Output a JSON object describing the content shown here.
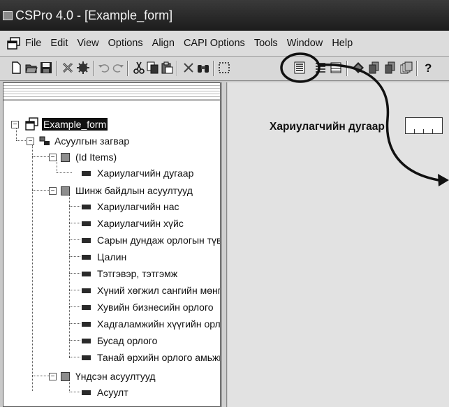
{
  "window": {
    "title": "CSPro 4.0 - [Example_form]"
  },
  "menu": {
    "items": [
      "File",
      "Edit",
      "View",
      "Options",
      "Align",
      "CAPI Options",
      "Tools",
      "Window",
      "Help"
    ]
  },
  "toolbar": {
    "buttons": [
      "new-icon",
      "open-icon",
      "save-icon",
      "cross-filled-icon",
      "gear-icon",
      "undo-icon",
      "redo-icon",
      "cut-icon",
      "copy-icon",
      "paste-icon",
      "delete-icon",
      "binoculars-icon",
      "select-box-icon",
      "roster-vertical-icon",
      "roster-horizontal-icon",
      "grid-icon",
      "diamond-icon",
      "page-stack-icon",
      "page-stack-2-icon",
      "pages-icon",
      "help-icon"
    ],
    "highlighted": "roster-vertical-icon"
  },
  "tree": {
    "root": "Example_form",
    "level": "Асуулгын загвар",
    "id_group": "(Id Items)",
    "id_items": [
      "Хариулагчийн дугаар"
    ],
    "record1": "Шинж байдлын асуултууд",
    "record1_items": [
      "Хариулагчийн нас",
      "Хариулагчийн хүйс",
      "Сарын дундаж орлогын түвш",
      "Цалин",
      "Тэтгэвэр, тэтгэмж",
      "Хүний хөгжил сангийн мөнгө",
      "Хувийн бизнесийн орлого",
      "Хадгаламжийн хүүгийн орлого",
      "Бусад орлого",
      "Танай өрхийн орлого амьжи"
    ],
    "record2": "Үндсэн асуултууд",
    "record2_items": [
      "Асуулт"
    ]
  },
  "form": {
    "field_label": "Хариулагчийн дугаар"
  },
  "colors": {
    "titlebar": "#1c1c1c",
    "selection": "#111111",
    "form_bg": "#e2e2e2"
  }
}
